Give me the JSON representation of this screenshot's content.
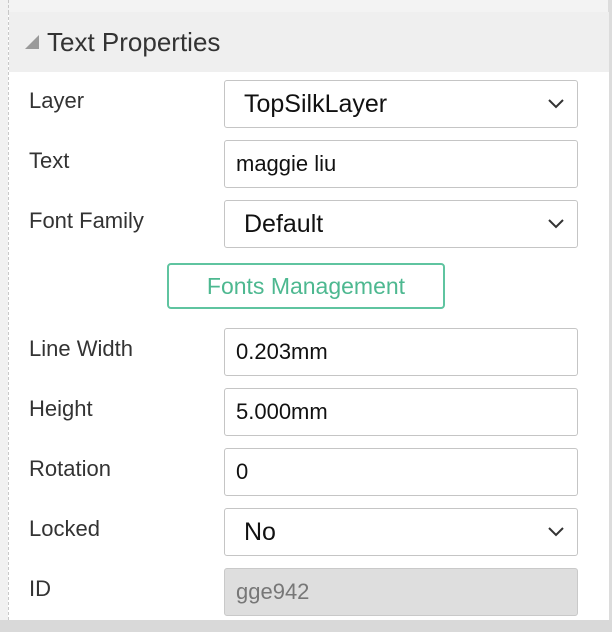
{
  "panel": {
    "title": "Text Properties",
    "fields": {
      "layer": {
        "label": "Layer",
        "value": "TopSilkLayer"
      },
      "text": {
        "label": "Text",
        "value": "maggie liu"
      },
      "font_family": {
        "label": "Font Family",
        "value": "Default"
      },
      "fonts_management": {
        "label": "Fonts Management"
      },
      "line_width": {
        "label": "Line Width",
        "value": "0.203mm"
      },
      "height": {
        "label": "Height",
        "value": "5.000mm"
      },
      "rotation": {
        "label": "Rotation",
        "value": "0"
      },
      "locked": {
        "label": "Locked",
        "value": "No"
      },
      "id": {
        "label": "ID",
        "value": "gge942"
      }
    }
  },
  "colors": {
    "accent": "#5fc4a0",
    "header_bg": "#efefef"
  }
}
